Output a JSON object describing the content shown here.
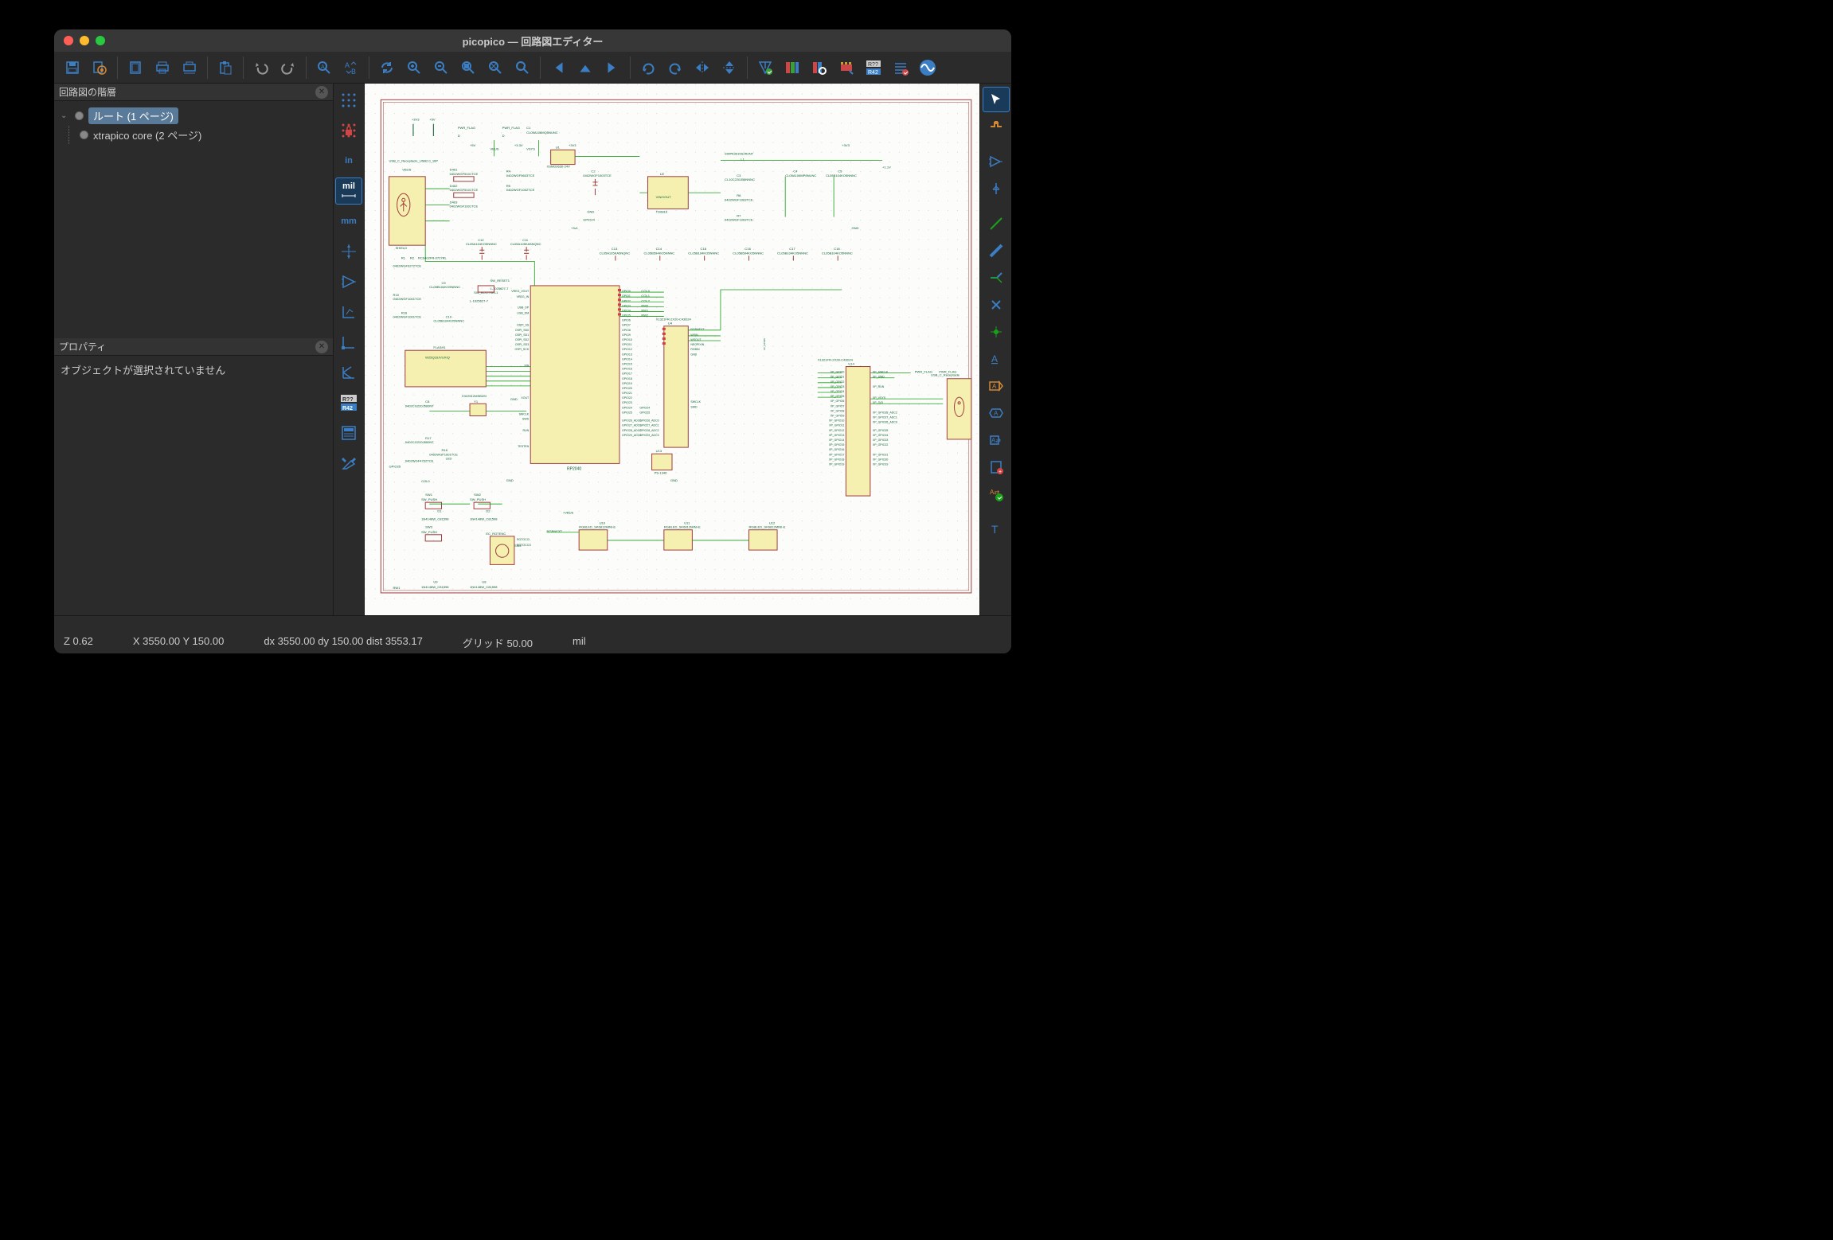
{
  "window": {
    "title": "picopico — 回路図エディター"
  },
  "panels": {
    "hierarchy": {
      "title": "回路図の階層"
    },
    "properties": {
      "title": "プロパティ",
      "empty": "オブジェクトが選択されていません"
    }
  },
  "tree": {
    "root": "ルート (1 ページ)",
    "child": "xtrapico core (2 ページ)"
  },
  "left_tools": {
    "in": "in",
    "mil": "mil",
    "mm": "mm"
  },
  "status": {
    "z": "Z 0.62",
    "xy": "X 3550.00  Y 150.00",
    "dxy": "dx 3550.00  dy 150.00  dist 3553.17",
    "grid": "グリッド 50.00",
    "unit": "mil"
  },
  "toolbar_icons": [
    "save-icon",
    "page-settings-icon",
    "",
    "page-icon",
    "print-icon",
    "plot-icon",
    "",
    "paste-icon",
    "",
    "undo-icon",
    "redo-icon",
    "",
    "find-icon",
    "find-replace-icon",
    "",
    "refresh-icon",
    "zoom-in-icon",
    "zoom-out-icon",
    "zoom-fit-icon",
    "zoom-object-icon",
    "zoom-selection-icon",
    "",
    "nav-back-icon",
    "nav-up-icon",
    "nav-forward-icon",
    "",
    "rotate-ccw-icon",
    "rotate-cw-icon",
    "mirror-h-icon",
    "mirror-v-icon",
    "",
    "erc-icon",
    "sym-editor-icon",
    "sym-browser-icon",
    "footprint-assign-icon",
    "annotate-icon",
    "bom-icon",
    "simulator-icon"
  ],
  "left_tool_icons": [
    "grid-dots-icon",
    "grid-lock-icon",
    "unit-in",
    "unit-mil",
    "unit-mm",
    "cursor-full-icon",
    "opamp-icon",
    "axis-l-icon",
    "axis-corner-icon",
    "axis-k-icon",
    "annotate-ref-icon",
    "sheet-icon",
    "tools-wrench-icon"
  ],
  "right_tool_icons": [
    "select-icon",
    "highlight-net-icon",
    "",
    "add-symbol-icon",
    "add-power-icon",
    "",
    "add-wire-icon",
    "add-bus-icon",
    "add-noconnect-icon",
    "add-junction-icon",
    "add-label-icon",
    "add-netclass-icon",
    "add-global-label-icon",
    "add-hier-label-icon",
    "add-sheet-pin-icon",
    "sync-pins-icon",
    "",
    "add-text-icon",
    "add-textbox-icon",
    "add-image-icon",
    "delete-icon"
  ],
  "schematic": {
    "components": [
      "USB_C_Receptacle_USB2.0_16P",
      "VBUS",
      "SHIELD",
      "D401",
      "0402WGF5101TCE",
      "D402",
      "0402WGF5101TCE",
      "D403",
      "0402WGF1001TCE",
      "R4",
      "0402WGF5603TCE",
      "R5",
      "0402WGF1002TCE",
      "PWR_FLAG",
      "C1",
      "CL05A106MQ5NUNC",
      "+5V",
      "+3V3",
      "+3.3V",
      "+1.1V",
      "C2",
      "0402WGF1003TCE",
      "U1",
      "XSMD0630-24V",
      "SWPA3015S2R2NT",
      "L1",
      "C3",
      "CL10C220JB8NNNC",
      "R6",
      "0402WGF1003TCE",
      "R7",
      "0402WGF1003TCE",
      "C4",
      "CL05A106MP8NUNC",
      "C5",
      "CL05B104KO5NNNC",
      "+1.1V",
      "GND",
      "+3v1",
      "R1",
      "R2",
      "RC0402FR-0727RL",
      "C12",
      "CL05A104KO5NNNC",
      "C11",
      "CL05A105KA5NQNC",
      "C13",
      "CL05A105KA5NQNC",
      "C14",
      "CL05B594KO5NNNC",
      "C15",
      "CL05B104KO5NNNC",
      "C16",
      "CL05B594KO5NNNC",
      "C17",
      "CL05B104KO5NNNC",
      "C18",
      "CL05B104KO5NNNC",
      "0402WGF0272TCE",
      "R10",
      "C9",
      "CL05B104KO5NNNC",
      "SW_BOOTSEL1",
      "SW_RESET1",
      "0402WGF1001TCE",
      "L-1025627-7",
      "L-1025627-7",
      "R16",
      "0402WGF1001TCE",
      "C19",
      "CL05B104KO5NNNC",
      "FLASH1",
      "W25Q16JVUXIQ",
      "XIN",
      "XOUT",
      "C8",
      "0402CG220J500NT",
      "Y1",
      "X322512MSB4SI",
      "R17",
      "0402CG220J500NT",
      "R18",
      "0402WGF1001TCE",
      "LED",
      "GPIO24",
      "GPIO25",
      "0402WGF4702TCE",
      "U2",
      "TD6810",
      "VREG_VOUT",
      "VREG_IN",
      "USB_DP",
      "USB_DM",
      "OSPI_SS",
      "OSPI_SD0",
      "OSPI_SD1",
      "OSPI_SD2",
      "OSPI_SD3",
      "OSPI_SCK",
      "SWCLK",
      "SWD",
      "RUN",
      "TESTEN",
      "RP2040",
      "GPIO0",
      "GPIO1",
      "GPIO2",
      "GPIO3",
      "GPIO4",
      "GPIO5",
      "GPIO6",
      "GPIO7",
      "GPIO8",
      "GPIO9",
      "GPIO10",
      "GPIO11",
      "GPIO12",
      "GPIO13",
      "GPIO14",
      "GPIO15",
      "GPIO16",
      "GPIO17",
      "GPIO18",
      "GPIO19",
      "GPIO20",
      "GPIO21",
      "GPIO22",
      "GPIO23",
      "GPIO24",
      "GPIO25",
      "GPIO26_ADC0",
      "GPIO27_ADC1",
      "GPIO28_ADC2",
      "GPIO29_ADC3",
      "COL0",
      "COL1",
      "COL2",
      "RW0",
      "RW1",
      "RW2",
      "RGBNEXT",
      "WSIN",
      "WSOUT",
      "NEOPIXIN",
      "RGBIN",
      "GND",
      "U4",
      "X1321FR-2X20-C43D24",
      "PS-1340",
      "U13",
      "SW1",
      "SW_PUSH",
      "SW2",
      "SW_PUSH",
      "SW3",
      "SW_PUSH",
      "SW4",
      "D1",
      "D2",
      "1N4148W_C81598",
      "1N4148W_C81598",
      "U9",
      "1N4148W_C81598",
      "U8",
      "1N4148W_C81598",
      "U10",
      "RGBLED_SK6812MINI-E",
      "U11",
      "RGBLED_SK6812MINI-E",
      "U12",
      "RGBLED_SK6812MINI-E",
      "EC_ROTENC",
      "ROTOCCI",
      "ROTOCCO",
      "U14",
      "X1321FR-2X28-C43D24",
      "XP_GPIO0",
      "XP_GPIO1",
      "XP_GPIO2",
      "XP_GPIO3",
      "XP_GPIO4",
      "XP_GPIO5",
      "XP_GPIO6",
      "XP_GPIO7",
      "XP_GPIO8",
      "XP_GPIO9",
      "XP_GPIO10",
      "XP_GPIO11",
      "XP_GPIO12",
      "XP_GPIO13",
      "XP_GPIO14",
      "XP_GPIO15",
      "XP_GPIO16",
      "XP_GPIO17",
      "XP_GPIO18",
      "XP_GPIO19",
      "XP_GPIO20",
      "XP_GPIO21",
      "XP_GPIO22",
      "XP_GPIO23",
      "XP_GPIO24",
      "XP_GPIO25",
      "XP_GPIO26_ADC0",
      "XP_GPIO27_ADC1",
      "XP_GPIO28_ADC2",
      "XP_SWCLK",
      "XP_SWD",
      "XP_RUN",
      "XP_VSYS",
      "XP_3V3",
      "PWR_FLAG",
      "USB_C_Receptacle"
    ]
  }
}
